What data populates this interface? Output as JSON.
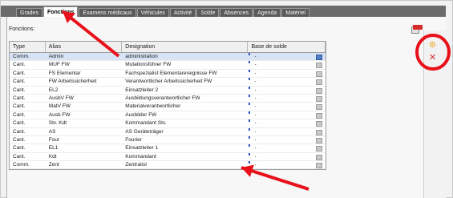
{
  "tabs": [
    {
      "label": "Grades",
      "active": false
    },
    {
      "label": "Fonctions",
      "active": true
    },
    {
      "label": "Examens médicaux",
      "active": false
    },
    {
      "label": "Véhicules",
      "active": false
    },
    {
      "label": "Activité",
      "active": false
    },
    {
      "label": "Solde",
      "active": false
    },
    {
      "label": "Absences",
      "active": false
    },
    {
      "label": "Agenda",
      "active": false
    },
    {
      "label": "Matériel",
      "active": false
    }
  ],
  "section_label": "Fonctions:",
  "columns": {
    "type": "Type",
    "alias": "Alias",
    "designation": "Designation",
    "base": "Base de solde"
  },
  "rows": [
    {
      "type": "Comm.",
      "alias": "Admin",
      "designation": "administration",
      "base": "-",
      "selected": true
    },
    {
      "type": "Cant.",
      "alias": "MUF FW",
      "designation": "Mutationsführer FW",
      "base": "-"
    },
    {
      "type": "Cant.",
      "alias": "FS Elementar",
      "designation": "Fachspezialist Elementarereignisse FW",
      "base": "-"
    },
    {
      "type": "Cant.",
      "alias": "FW Arbeitssicherheit",
      "designation": "Verantwortlicher Arbeitssicherheit FW",
      "base": "-"
    },
    {
      "type": "Cant.",
      "alias": "EL2",
      "designation": "Einsatzleiter 2",
      "base": "-"
    },
    {
      "type": "Cant.",
      "alias": "AusbV FW",
      "designation": "Ausbildungsverantwortlicher FW",
      "base": "-"
    },
    {
      "type": "Cant.",
      "alias": "MatV FW",
      "designation": "Materialverantwortlicher",
      "base": "-"
    },
    {
      "type": "Cant.",
      "alias": "Ausb FW",
      "designation": "Ausbilder FW",
      "base": "-"
    },
    {
      "type": "Cant.",
      "alias": "Stv. Kdt",
      "designation": "Kommandant Stv.",
      "base": "-"
    },
    {
      "type": "Cant.",
      "alias": "AS",
      "designation": "AS Geräteträger",
      "base": "-"
    },
    {
      "type": "Cant.",
      "alias": "Four",
      "designation": "Fourier",
      "base": "-"
    },
    {
      "type": "Cant.",
      "alias": "EL1",
      "designation": "Einsatzleiter 1",
      "base": "-"
    },
    {
      "type": "Cant.",
      "alias": "Kdt",
      "designation": "Kommandant",
      "base": "-"
    },
    {
      "type": "Comm.",
      "alias": "Zent",
      "designation": "Zentralist",
      "base": "-"
    }
  ],
  "icons": {
    "add": "gear-add-icon",
    "delete": "close-icon"
  },
  "colors": {
    "annotation": "#e8101a",
    "selected_row": "#d8e4f5",
    "tabstrip": "#6b6b6b"
  }
}
